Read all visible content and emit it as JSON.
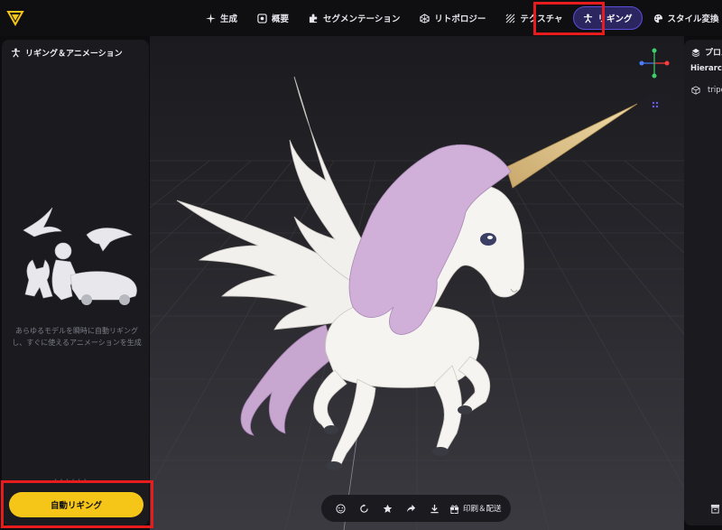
{
  "nav": {
    "items": [
      {
        "label": "生成",
        "icon": "sparkle-icon"
      },
      {
        "label": "概要",
        "icon": "overview-icon"
      },
      {
        "label": "セグメンテーション",
        "icon": "puzzle-icon"
      },
      {
        "label": "リトポロジー",
        "icon": "mesh-icon"
      },
      {
        "label": "テクスチャ",
        "icon": "texture-icon"
      },
      {
        "label": "リギング",
        "icon": "rigging-figure-icon",
        "active": true
      },
      {
        "label": "スタイル変換",
        "icon": "palette-icon"
      }
    ]
  },
  "left_panel": {
    "title": "リギング＆アニメーション",
    "description": "あらゆるモデルを瞬時に自動リギングし、すぐに使えるアニメーションを生成",
    "auto_rig_label": "自動リギング"
  },
  "right_panel": {
    "title": "プロパ",
    "hierarchy_label": "Hierarchy",
    "object_name": "tripo"
  },
  "toolbar": {
    "print_ship_label": "印刷＆配送"
  },
  "colors": {
    "accent_yellow": "#f5c518",
    "active_tab_bg": "#2b2660",
    "highlight_red": "#e81c1c"
  }
}
